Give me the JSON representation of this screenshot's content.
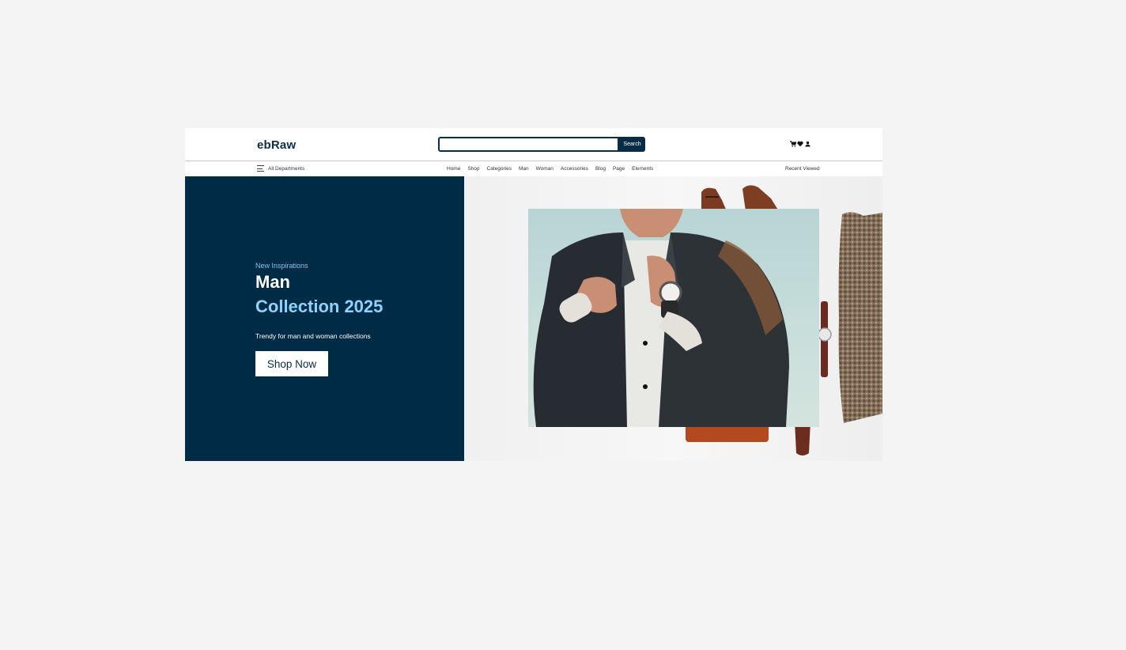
{
  "header": {
    "logo": "ebRaw",
    "search": {
      "placeholder": "",
      "button_label": "Search"
    },
    "icons": [
      "cart-icon",
      "heart-icon",
      "user-icon"
    ]
  },
  "nav": {
    "departments_label": "All Departments",
    "links": [
      "Home",
      "Shop",
      "Categories",
      "Man",
      "Woman",
      "Accessories",
      "Blog",
      "Page",
      "Elements"
    ],
    "recent_label": "Recent Viewed"
  },
  "hero": {
    "kicker": "New Inspirations",
    "title_line1": "Man",
    "title_line2": "Collection 2025",
    "subtitle": "Trendy for man and woman collections",
    "cta_label": "Shop Now"
  },
  "colors": {
    "brand_dark": "#002b46",
    "accent_light": "#8fd3fb",
    "kicker": "#7ec4ee",
    "background": "#f4f4f4"
  }
}
